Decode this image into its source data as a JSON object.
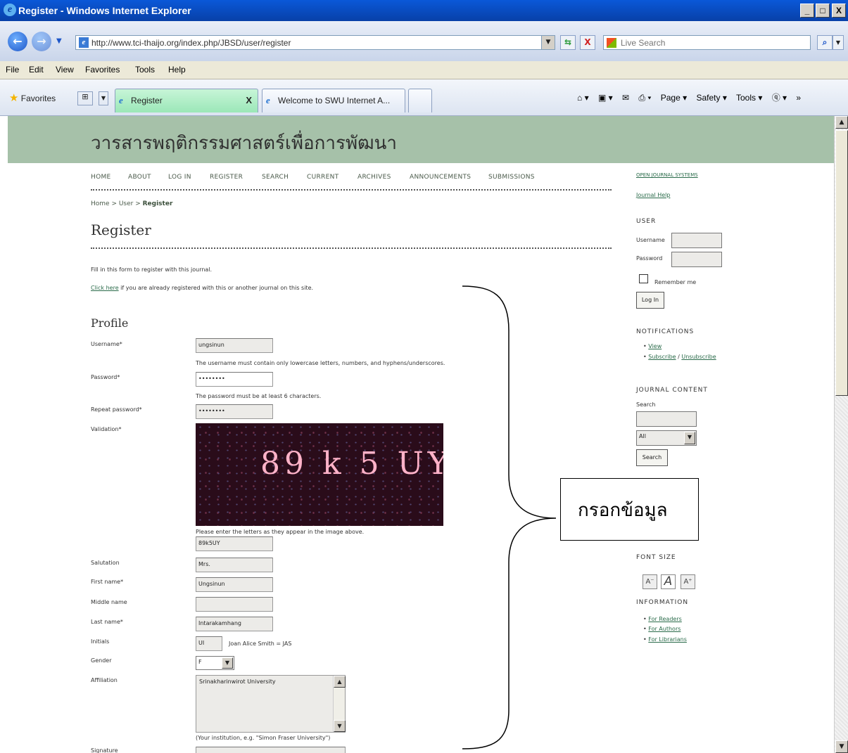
{
  "window": {
    "title": "Register - Windows Internet Explorer",
    "min": "_",
    "max": "□",
    "close": "X"
  },
  "address": {
    "url": "http://www.tci-thaijo.org/index.php/JBSD/user/register",
    "search_placeholder": "Live Search"
  },
  "menu": [
    "File",
    "Edit",
    "View",
    "Favorites",
    "Tools",
    "Help"
  ],
  "favorites_label": "Favorites",
  "tabs": [
    {
      "label": "Register",
      "close": "X"
    },
    {
      "label": "Welcome to SWU Internet A..."
    }
  ],
  "command_bar": [
    "Page ▾",
    "Safety ▾",
    "Tools ▾"
  ],
  "page": {
    "journal_title": "วารสารพฤติกรรมศาสตร์เพื่อการพัฒนา",
    "nav": [
      "HOME",
      "ABOUT",
      "LOG IN",
      "REGISTER",
      "SEARCH",
      "CURRENT",
      "ARCHIVES",
      "ANNOUNCEMENTS",
      "SUBMISSIONS"
    ],
    "breadcrumb": {
      "home": "Home",
      "sep1": " > ",
      "user": "User",
      "sep2": " > ",
      "current": "Register"
    },
    "title": "Register",
    "intro": "Fill in this form to register with this journal.",
    "click_here": "Click here",
    "click_here_rest": " if you are already registered with this or another journal on this site.",
    "section": "Profile",
    "fields": {
      "username_label": "Username*",
      "username_value": "ungsinun",
      "username_note": "The username must contain only lowercase letters, numbers, and hyphens/underscores.",
      "password_label": "Password*",
      "password_value": "••••••••",
      "password_note": "The password must be at least 6 characters.",
      "repeat_label": "Repeat password*",
      "repeat_value": "••••••••",
      "validation_label": "Validation*",
      "captcha_text": "89 k 5 UY",
      "validation_note": "Please enter the letters as they appear in the image above.",
      "validation_value": "89k5UY",
      "salutation_label": "Salutation",
      "salutation_value": "Mrs.",
      "first_label": "First name*",
      "first_value": "Ungsinun",
      "middle_label": "Middle name",
      "middle_value": "",
      "last_label": "Last name*",
      "last_value": "Intarakamhang",
      "initials_label": "Initials",
      "initials_value": "UI",
      "initials_example": "Joan Alice Smith = JAS",
      "gender_label": "Gender",
      "gender_value": "F",
      "affiliation_label": "Affiliation",
      "affiliation_value": "Srinakharinwirot University",
      "affiliation_note": "(Your institution, e.g. \"Simon Fraser University\")",
      "signature_label": "Signature"
    }
  },
  "sidebar": {
    "ojs": "OPEN JOURNAL SYSTEMS",
    "journal_help": "Journal Help",
    "user_head": "USER",
    "username": "Username",
    "password": "Password",
    "remember": "Remember me",
    "login_btn": "Log In",
    "notifications_head": "NOTIFICATIONS",
    "view": "View",
    "subscribe": "Subscribe",
    "slash": " / ",
    "unsubscribe": "Unsubscribe",
    "content_head": "JOURNAL CONTENT",
    "search_label": "Search",
    "scope": "All",
    "search_btn": "Search",
    "font_head": "FONT SIZE",
    "info_head": "INFORMATION",
    "readers": "For Readers",
    "authors": "For Authors",
    "librarians": "For Librarians"
  },
  "annotation": "กรอกข้อมูล"
}
